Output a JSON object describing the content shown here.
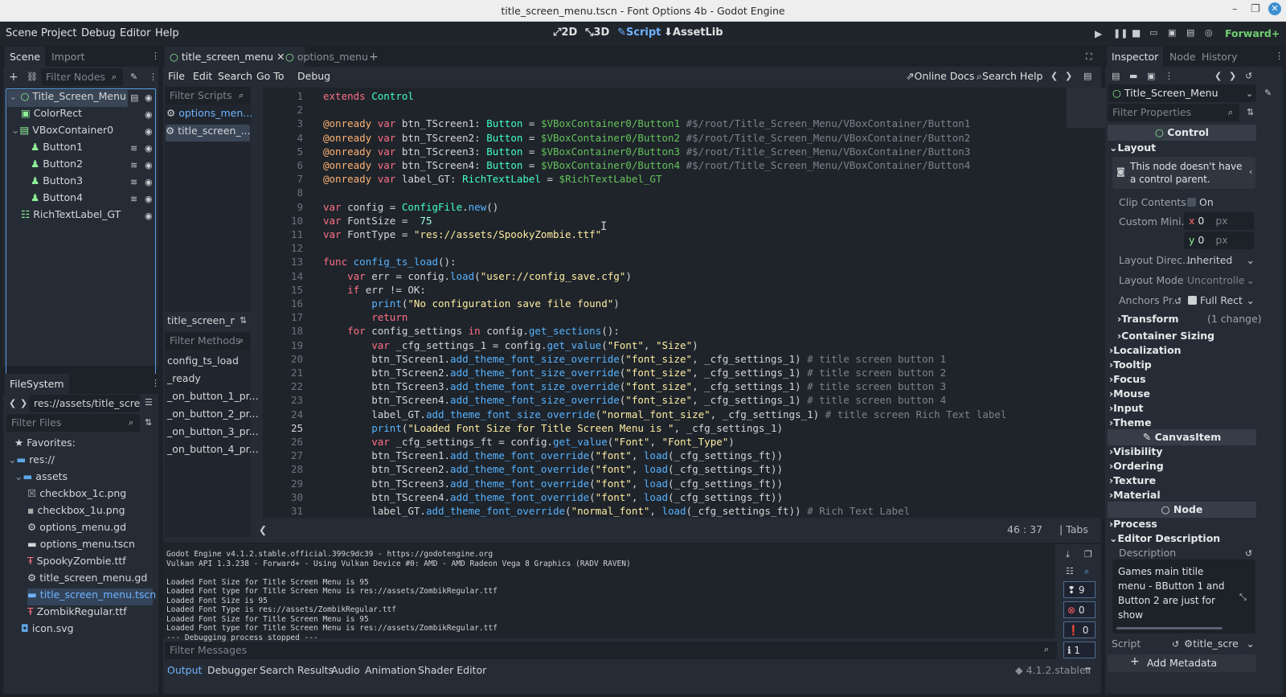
{
  "window": {
    "title": "title_screen_menu.tscn - Font Options 4b - Godot Engine"
  },
  "menubar": {
    "items": [
      "Scene",
      "Project",
      "Debug",
      "Editor",
      "Help"
    ]
  },
  "workspaces": [
    {
      "label": "2D",
      "icon": "2d-icon"
    },
    {
      "label": "3D",
      "icon": "3d-icon"
    },
    {
      "label": "Script",
      "icon": "script-icon"
    },
    {
      "label": "AssetLib",
      "icon": "assetlib-icon"
    }
  ],
  "renderer": "Forward+",
  "scene_dock": {
    "tabs": [
      "Scene",
      "Import"
    ],
    "filter_placeholder": "Filter Nodes",
    "nodes": [
      {
        "label": "Title_Screen_Menu",
        "depth": 0,
        "color": "#8eef97"
      },
      {
        "label": "ColorRect",
        "depth": 1,
        "color": "#8eef97"
      },
      {
        "label": "VBoxContainer0",
        "depth": 1,
        "color": "#8eef97"
      },
      {
        "label": "Button1",
        "depth": 2,
        "color": "#8eef97"
      },
      {
        "label": "Button2",
        "depth": 2,
        "color": "#8eef97"
      },
      {
        "label": "Button3",
        "depth": 2,
        "color": "#8eef97"
      },
      {
        "label": "Button4",
        "depth": 2,
        "color": "#8eef97"
      },
      {
        "label": "RichTextLabel_GT",
        "depth": 1,
        "color": "#8eef97"
      }
    ]
  },
  "filesystem": {
    "tab": "FileSystem",
    "path": "res://assets/title_screen",
    "filter_placeholder": "Filter Files",
    "items": [
      {
        "label": "Favorites:",
        "depth": 0
      },
      {
        "label": "res://",
        "depth": 0
      },
      {
        "label": "assets",
        "depth": 1
      },
      {
        "label": "checkbox_1c.png",
        "depth": 2
      },
      {
        "label": "checkbox_1u.png",
        "depth": 2
      },
      {
        "label": "options_menu.gd",
        "depth": 2
      },
      {
        "label": "options_menu.tscn",
        "depth": 2
      },
      {
        "label": "SpookyZombie.ttf",
        "depth": 2
      },
      {
        "label": "title_screen_menu.gd",
        "depth": 2
      },
      {
        "label": "title_screen_menu.tscn",
        "depth": 2
      },
      {
        "label": "ZombikRegular.ttf",
        "depth": 2
      },
      {
        "label": "icon.svg",
        "depth": 1
      }
    ]
  },
  "editor_tabs": [
    "title_screen_menu",
    "options_menu"
  ],
  "script_menu": [
    "File",
    "Edit",
    "Search",
    "Go To",
    "Debug"
  ],
  "script_toolbar": {
    "online_docs": "Online Docs",
    "search_help": "Search Help"
  },
  "scripts_panel": {
    "filter_placeholder": "Filter Scripts",
    "scripts": [
      "options_men...",
      "title_screen_..."
    ],
    "current": "title_screen_me",
    "methods_placeholder": "Filter Methods",
    "methods": [
      "config_ts_load",
      "_ready",
      "_on_button_1_pr...",
      "_on_button_2_pr...",
      "_on_button_3_pr...",
      "_on_button_4_pr..."
    ]
  },
  "code": {
    "lines": [
      "<span class=kw>extends</span> <span class=ty>Control</span>",
      "",
      "<span class=an>@onready</span> <span class=kw>var</span> btn_TScreen1: <span class=ty>Button</span> = <span class=nd>$VBoxContainer0/Button1</span> <span class=cm>#$/root/Title_Screen_Menu/VBoxContainer/Button1</span>",
      "<span class=an>@onready</span> <span class=kw>var</span> btn_TScreen2: <span class=ty>Button</span> = <span class=nd>$VBoxContainer0/Button2</span> <span class=cm>#$/root/Title_Screen_Menu/VBoxContainer/Button2</span>",
      "<span class=an>@onready</span> <span class=kw>var</span> btn_TScreen3: <span class=ty>Button</span> = <span class=nd>$VBoxContainer0/Button3</span> <span class=cm>#$/root/Title_Screen_Menu/VBoxContainer/Button3</span>",
      "<span class=an>@onready</span> <span class=kw>var</span> btn_TScreen4: <span class=ty>Button</span> = <span class=nd>$VBoxContainer0/Button4</span> <span class=cm>#$/root/Title_Screen_Menu/VBoxContainer/Button4</span>",
      "<span class=an>@onready</span> <span class=kw>var</span> label_GT: <span class=ty>RichTextLabel</span> = <span class=nd>$RichTextLabel_GT</span>",
      "",
      "<span class=kw>var</span> config = <span class=ty>ConfigFile</span>.<span class=fn>new</span>()",
      "<span class=kw>var</span> FontSize =  <span class=nm>75</span>",
      "<span class=kw>var</span> FontType = <span class=st>\"res://assets/SpookyZombie.ttf\"</span>",
      "",
      "<span class=kw>func</span> <span class=fn>config_ts_load</span>():",
      "    <span class=kw>var</span> err = config.<span class=fn>load</span>(<span class=st>\"user://config_save.cfg\"</span>)",
      "    <span class=kw>if</span> err != OK:",
      "        <span class=fn>print</span>(<span class=st>\"No configuration save file found\"</span>)",
      "        <span class=kw>return</span>",
      "    <span class=kw>for</span> config_settings <span class=kw>in</span> config.<span class=fn>get_sections</span>():",
      "        <span class=kw>var</span> _cfg_settings_1 = config.<span class=fn>get_value</span>(<span class=st>\"Font\"</span>, <span class=st>\"Size\"</span>)",
      "        btn_TScreen1.<span class=fn>add_theme_font_size_override</span>(<span class=st>\"font_size\"</span>, _cfg_settings_1) <span class=cm># title screen button 1</span>",
      "        btn_TScreen2.<span class=fn>add_theme_font_size_override</span>(<span class=st>\"font_size\"</span>, _cfg_settings_1) <span class=cm># title screen button 2</span>",
      "        btn_TScreen3.<span class=fn>add_theme_font_size_override</span>(<span class=st>\"font_size\"</span>, _cfg_settings_1) <span class=cm># title screen button 3</span>",
      "        btn_TScreen4.<span class=fn>add_theme_font_size_override</span>(<span class=st>\"font_size\"</span>, _cfg_settings_1) <span class=cm># title screen button 4</span>",
      "        label_GT.<span class=fn>add_theme_font_size_override</span>(<span class=st>\"normal_font_size\"</span>, _cfg_settings_1) <span class=cm># title screen Rich Text label</span>",
      "        <span class=fn>print</span>(<span class=st>\"Loaded Font Size for Title Screen Menu is \"</span>, _cfg_settings_1)",
      "        <span class=kw>var</span> _cfg_settings_ft = config.<span class=fn>get_value</span>(<span class=st>\"Font\"</span>, <span class=st>\"Font_Type\"</span>)",
      "        btn_TScreen1.<span class=fn>add_theme_font_override</span>(<span class=st>\"font\"</span>, <span class=fn>load</span>(_cfg_settings_ft))",
      "        btn_TScreen2.<span class=fn>add_theme_font_override</span>(<span class=st>\"font\"</span>, <span class=fn>load</span>(_cfg_settings_ft))",
      "        btn_TScreen3.<span class=fn>add_theme_font_override</span>(<span class=st>\"font\"</span>, <span class=fn>load</span>(_cfg_settings_ft))",
      "        btn_TScreen4.<span class=fn>add_theme_font_override</span>(<span class=st>\"font\"</span>, <span class=fn>load</span>(_cfg_settings_ft))",
      "        label_GT.<span class=fn>add_theme_font_override</span>(<span class=st>\"normal_font\"</span>, <span class=fn>load</span>(_cfg_settings_ft)) <span class=cm># Rich Text Label</span>"
    ],
    "line_numbers": [
      "1",
      "2",
      "3",
      "4",
      "5",
      "6",
      "7",
      "8",
      "9",
      "10",
      "11",
      "12",
      "13",
      "14",
      "15",
      "16",
      "17",
      "18",
      "19",
      "20",
      "21",
      "22",
      "23",
      "24",
      "25",
      "26",
      "27",
      "28",
      "29",
      "30",
      "31"
    ],
    "current_line": "25"
  },
  "statusbar": {
    "position": "46 :   37",
    "indent": "Tabs"
  },
  "output": {
    "lines": [
      "Godot Engine v4.1.2.stable.official.399c9dc39 - https://godotengine.org",
      "Vulkan API 1.3.238 - Forward+ - Using Vulkan Device #0: AMD - AMD Radeon Vega 8 Graphics (RADV RAVEN)",
      "",
      "Loaded Font Size for Title Screen Menu is 95",
      "Loaded Font type for Title Screen Menu is res://assets/ZombikRegular.ttf",
      "Loaded Font Size is 95",
      "Loaded Font Type is res://assets/ZombikRegular.ttf",
      "Loaded Font Size for Title Screen Menu is 95",
      "Loaded Font type for Title Screen Menu is res://assets/ZombikRegular.ttf",
      "--- Debugging process stopped ---"
    ],
    "filter_placeholder": "Filter Messages",
    "counts": {
      "messages": "9",
      "errors": "0",
      "warnings": "0",
      "info": "1"
    }
  },
  "bottom_tabs": [
    "Output",
    "Debugger",
    "Search Results",
    "Audio",
    "Animation",
    "Shader Editor"
  ],
  "version": "4.1.2.stable",
  "inspector": {
    "tabs": [
      "Inspector",
      "Node",
      "History"
    ],
    "object": "Title_Screen_Menu",
    "filter_placeholder": "Filter Properties",
    "control_header": "Control",
    "layout": "Layout",
    "warning": "This node doesn't have a control parent.",
    "clip_contents": {
      "label": "Clip Contents",
      "value": "On"
    },
    "custom_min": {
      "label": "Custom Mini...",
      "x": "0",
      "y": "0",
      "unit": "px"
    },
    "layout_direction": {
      "label": "Layout Direc...",
      "value": "Inherited"
    },
    "layout_mode": {
      "label": "Layout Mode",
      "value": "Uncontrolle"
    },
    "anchors": {
      "label": "Anchors Pr...",
      "value": "Full Rect"
    },
    "transform": {
      "label": "Transform",
      "note": "(1 change)"
    },
    "sections1": [
      "Container Sizing",
      "Localization",
      "Tooltip",
      "Focus",
      "Mouse",
      "Input",
      "Theme"
    ],
    "canvasitem_header": "CanvasItem",
    "sections2": [
      "Visibility",
      "Ordering",
      "Texture",
      "Material"
    ],
    "node_header": "Node",
    "sections3": [
      "Process",
      "Editor Description"
    ],
    "description_label": "Description",
    "description": "Games main titile menu - BButton 1 and Button 2 are just for show",
    "script": {
      "label": "Script",
      "value": "title_scre"
    },
    "add_metadata": "Add Metadata"
  }
}
